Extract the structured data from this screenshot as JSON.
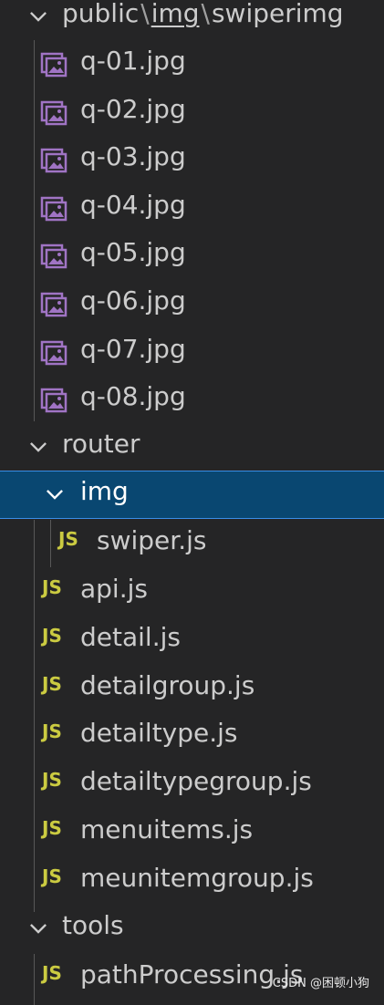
{
  "header": {
    "seg1": "public",
    "sep": "\\",
    "seg2": "img",
    "seg3": "swiperimg"
  },
  "swiperimg_files": [
    "q-01.jpg",
    "q-02.jpg",
    "q-03.jpg",
    "q-04.jpg",
    "q-05.jpg",
    "q-06.jpg",
    "q-07.jpg",
    "q-08.jpg"
  ],
  "router": {
    "label": "router",
    "img_folder": "img",
    "img_files": [
      "swiper.js"
    ],
    "files": [
      "api.js",
      "detail.js",
      "detailgroup.js",
      "detailtype.js",
      "detailtypegroup.js",
      "menuitems.js",
      "meunitemgroup.js"
    ]
  },
  "tools": {
    "label": "tools",
    "files": [
      "pathProcessing.js"
    ]
  },
  "js_icon_text": "JS",
  "watermark": "CSDN @困顿小狗",
  "colors": {
    "background": "#252526",
    "selected_bg": "#094771",
    "selected_border": "#3a8ee6",
    "js_icon": "#cbcb41",
    "image_icon": "#a074c4"
  }
}
